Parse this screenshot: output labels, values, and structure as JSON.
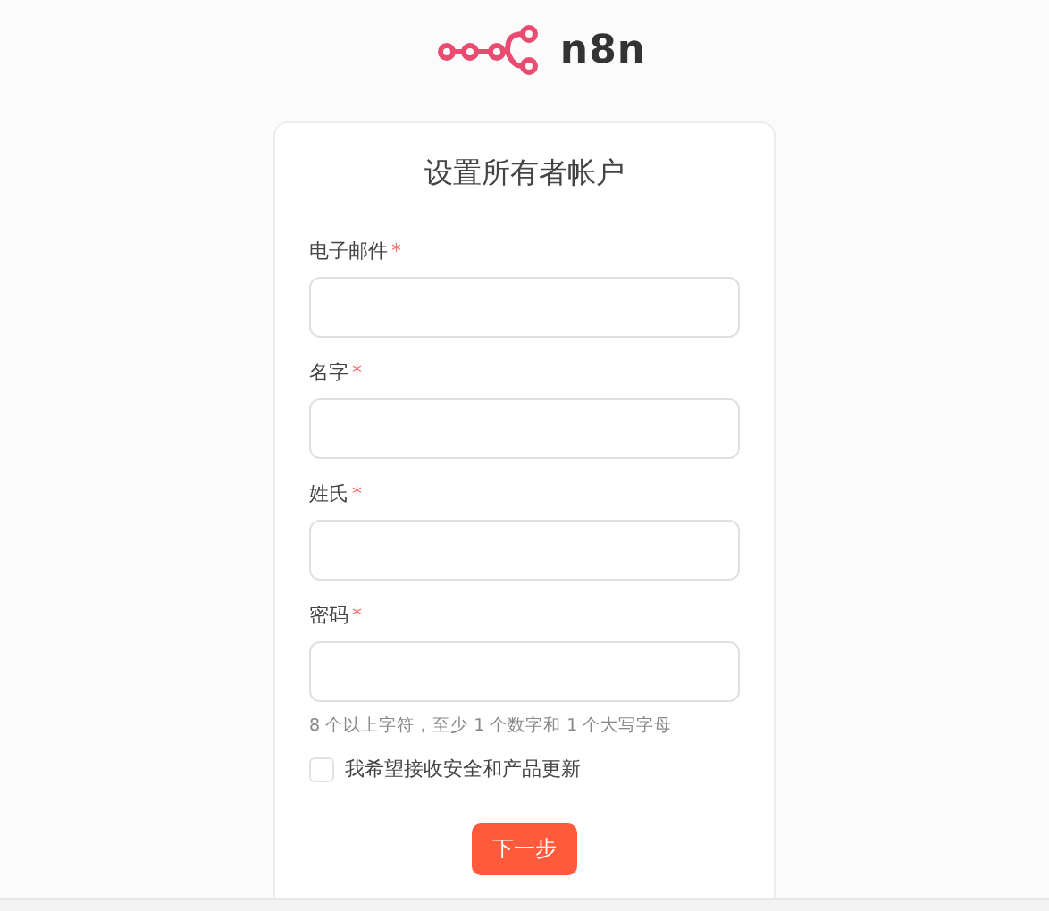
{
  "logo": {
    "text": "n8n"
  },
  "form": {
    "title": "设置所有者帐户",
    "fields": [
      {
        "label": "电子邮件",
        "required_mark": "*"
      },
      {
        "label": "名字",
        "required_mark": "*"
      },
      {
        "label": "姓氏",
        "required_mark": "*"
      },
      {
        "label": "密码",
        "required_mark": "*",
        "hint": "8 个以上字符，至少 1 个数字和 1 个大写字母"
      }
    ],
    "checkbox": {
      "label": "我希望接收安全和产品更新",
      "checked": false
    },
    "submit": "下一步"
  }
}
